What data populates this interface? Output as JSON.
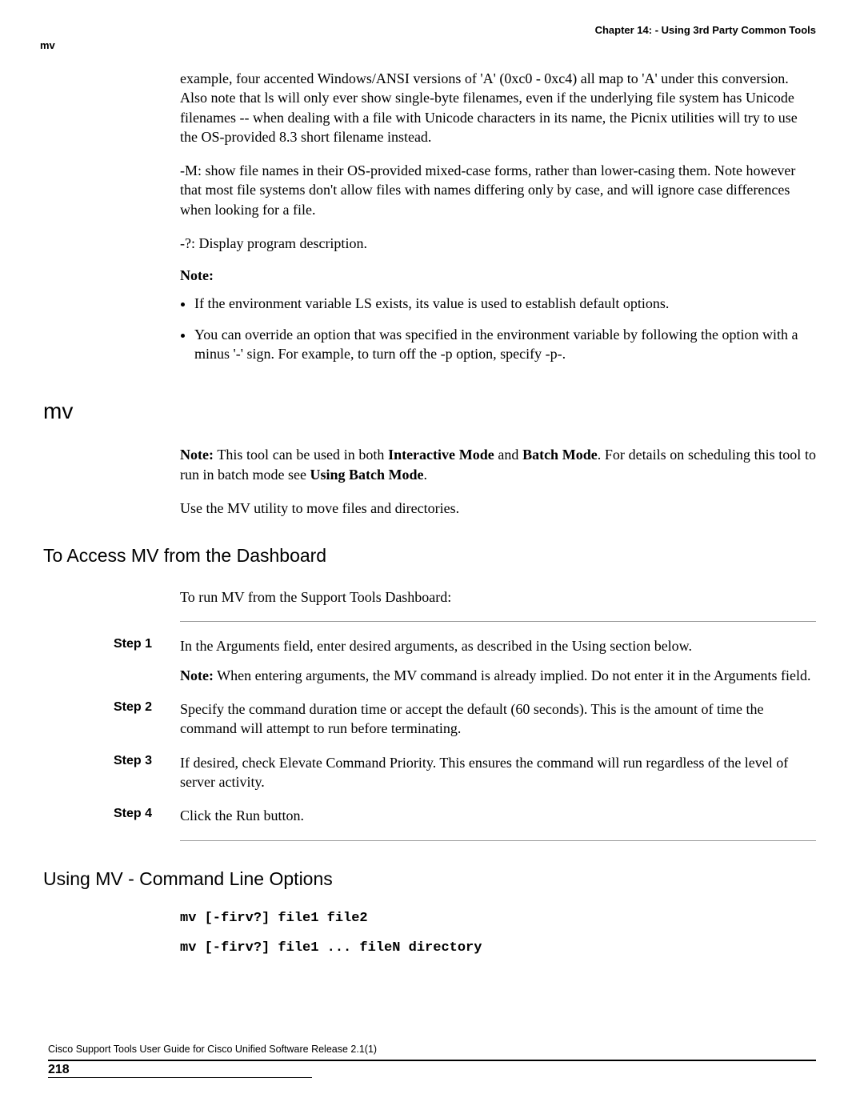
{
  "chapter_header": "Chapter 14: - Using 3rd Party Common Tools",
  "side_label": "mv",
  "intro_paragraphs": {
    "p1": "example, four accented Windows/ANSI versions of 'A' (0xc0 - 0xc4) all map to 'A' under this conversion. Also note that ls will only ever show single-byte filenames, even if the underlying file system has Unicode filenames -- when dealing with a file with Unicode characters in its name, the Picnix utilities will try to use the OS-provided 8.3 short filename instead.",
    "p2": "-M: show file names in their OS-provided mixed-case forms, rather than lower-casing them. Note however that most file systems don't allow files with names differing only by case, and will ignore case differences when looking for a file.",
    "p3": "-?: Display program description."
  },
  "note_label": "Note:",
  "note_items": [
    "If the environment variable LS exists, its value is used to establish default options.",
    "You can override an option that was specified in the environment variable by following the option with a minus '-' sign. For example, to turn off the -p option, specify -p-."
  ],
  "section_mv_heading": "mv",
  "mv_note": {
    "prefix": "Note:",
    "t1": " This tool can be used in both ",
    "b1": "Interactive Mode",
    "t2": " and ",
    "b2": "Batch Mode",
    "t3": ". For details on scheduling this tool to run in batch mode see ",
    "b3": "Using Batch Mode",
    "t4": "."
  },
  "mv_desc": "Use the MV utility to move files and directories.",
  "access_heading": "To Access MV from the Dashboard",
  "access_intro": "To run MV from the Support Tools Dashboard:",
  "steps": [
    {
      "label": "Step 1",
      "body": "In the Arguments field, enter desired arguments, as described in the Using section below.",
      "sub_prefix": "Note:",
      "sub_body": " When entering arguments, the MV command is already implied. Do not enter it in the Arguments field."
    },
    {
      "label": "Step 2",
      "body": "Specify the command duration time or accept the default (60 seconds). This is the amount of time the command will attempt to run before terminating."
    },
    {
      "label": "Step 3",
      "body": "If desired, check Elevate Command Priority. This ensures the command will run regardless of the level of server activity."
    },
    {
      "label": "Step 4",
      "body": "Click the Run button."
    }
  ],
  "cli_heading": "Using MV - Command Line Options",
  "cli_lines": {
    "l1": "mv [-firv?] file1 file2",
    "l2": "mv [-firv?] file1 ... fileN directory"
  },
  "footer_doc": "Cisco Support Tools User Guide for Cisco Unified Software Release 2.1(1)",
  "page_number": "218"
}
